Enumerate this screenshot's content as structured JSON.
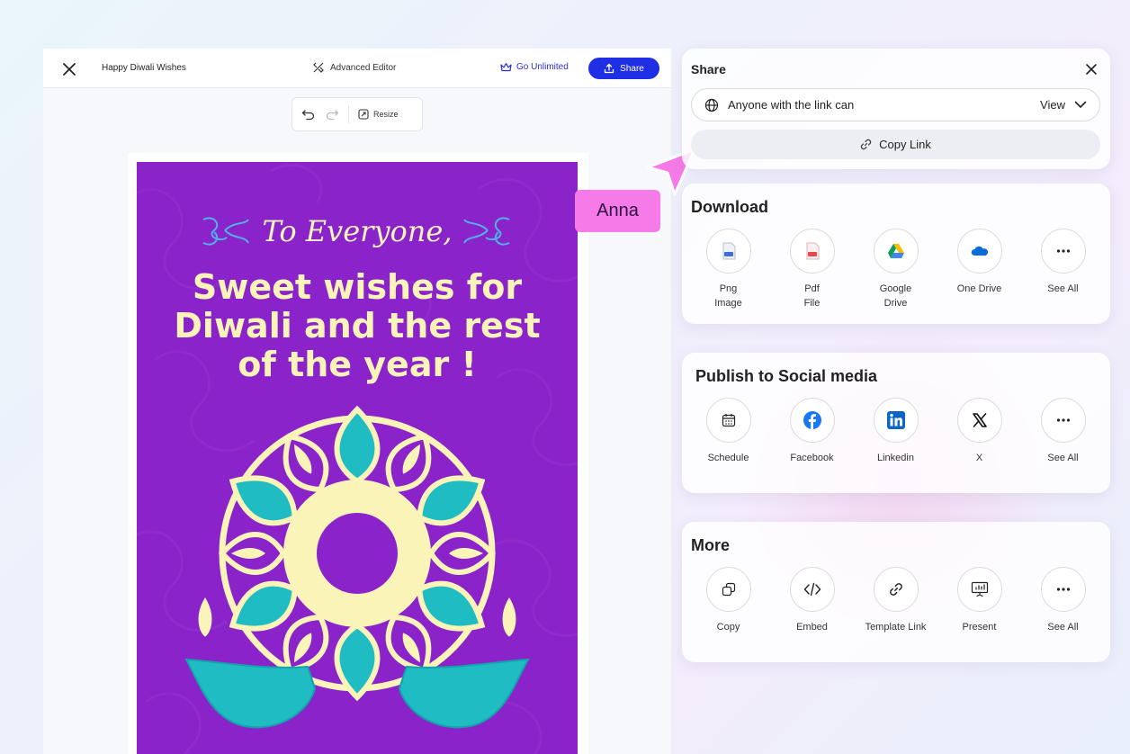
{
  "editor": {
    "doc_title": "Happy Diwali Wishes",
    "advanced_editor": "Advanced Editor",
    "go_unlimited": "Go Unlimited",
    "share": "Share",
    "resize": "Resize"
  },
  "card": {
    "greeting": "To Everyone,",
    "headline": "Sweet wishes for Diwali and the rest of the year !"
  },
  "cursor": {
    "name": "Anna",
    "color": "#f67ae7"
  },
  "share_panel": {
    "title": "Share",
    "access_label": "Anyone with the link can",
    "access_value": "View",
    "copy_link": "Copy Link"
  },
  "download": {
    "title": "Download",
    "items": [
      {
        "line1": "Png",
        "line2": "Image",
        "icon": "png-file-icon"
      },
      {
        "line1": "Pdf",
        "line2": "File",
        "icon": "pdf-file-icon"
      },
      {
        "line1": "Google",
        "line2": "Drive",
        "icon": "google-drive-icon"
      },
      {
        "line1": "One Drive",
        "line2": "",
        "icon": "onedrive-icon"
      },
      {
        "line1": "See All",
        "line2": "",
        "icon": "more-icon"
      }
    ]
  },
  "social": {
    "title": "Publish to Social media",
    "items": [
      {
        "label": "Schedule",
        "icon": "calendar-icon"
      },
      {
        "label": "Facebook",
        "icon": "facebook-icon"
      },
      {
        "label": "Linkedin",
        "icon": "linkedin-icon"
      },
      {
        "label": "X",
        "icon": "x-icon"
      },
      {
        "label": "See All",
        "icon": "more-icon"
      }
    ]
  },
  "more": {
    "title": "More",
    "items": [
      {
        "label": "Copy",
        "icon": "copy-icon"
      },
      {
        "label": "Embed",
        "icon": "code-icon"
      },
      {
        "label": "Template Link",
        "icon": "link-icon"
      },
      {
        "label": "Present",
        "icon": "present-icon"
      },
      {
        "label": "See All",
        "icon": "more-icon"
      }
    ]
  },
  "colors": {
    "accent": "#1f2fe6",
    "card_purple": "#8a23c9",
    "card_cream": "#fbf4b8",
    "card_teal": "#1fbcc4"
  }
}
